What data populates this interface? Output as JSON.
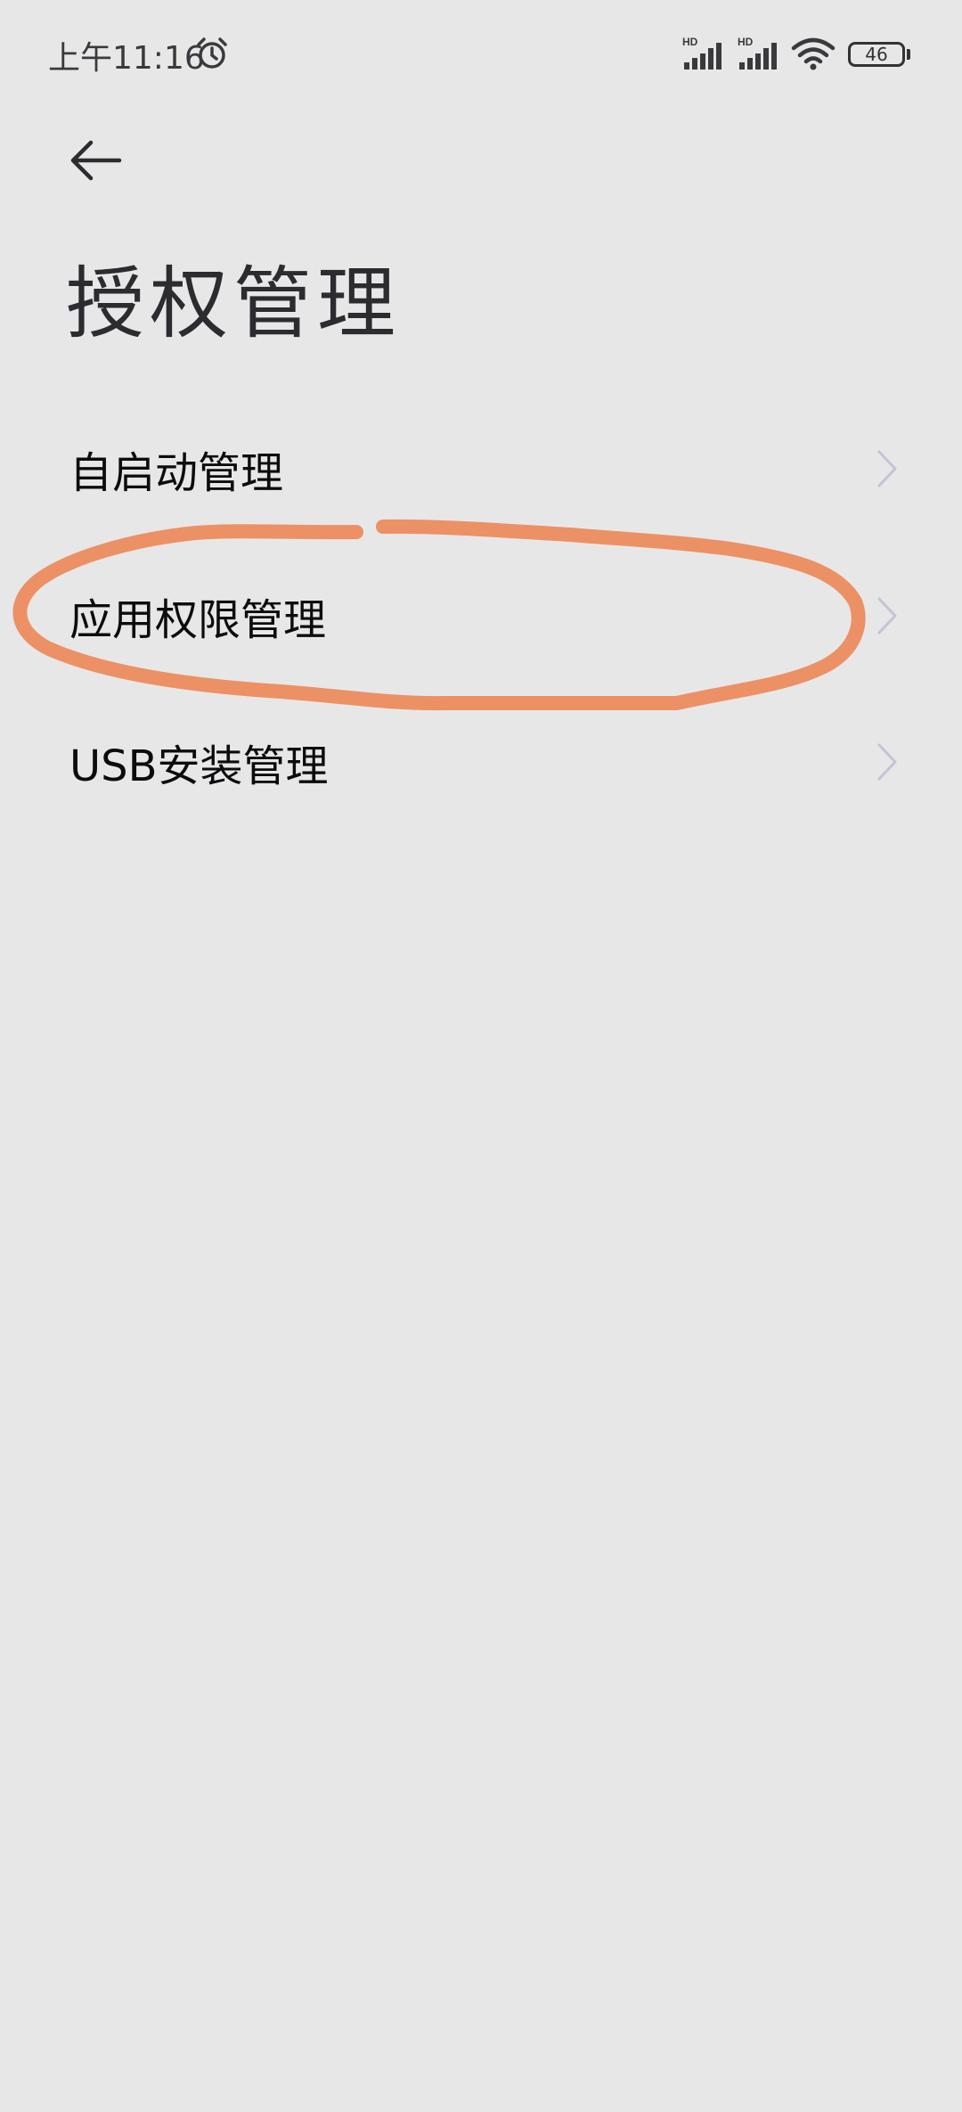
{
  "status_bar": {
    "time": "上午11:16",
    "alarm_icon": "alarm-clock-icon",
    "signal1_label": "HD",
    "signal2_label": "HD",
    "wifi_icon": "wifi-icon",
    "battery": "46"
  },
  "header": {
    "back_icon": "arrow-left-icon",
    "title": "授权管理"
  },
  "menu": {
    "items": [
      {
        "label": "自启动管理",
        "icon": "chevron-right-icon"
      },
      {
        "label": "应用权限管理",
        "icon": "chevron-right-icon"
      },
      {
        "label": "USB安装管理",
        "icon": "chevron-right-icon"
      }
    ]
  },
  "annotation": {
    "color": "#ec9165",
    "highlights": "应用权限管理"
  }
}
